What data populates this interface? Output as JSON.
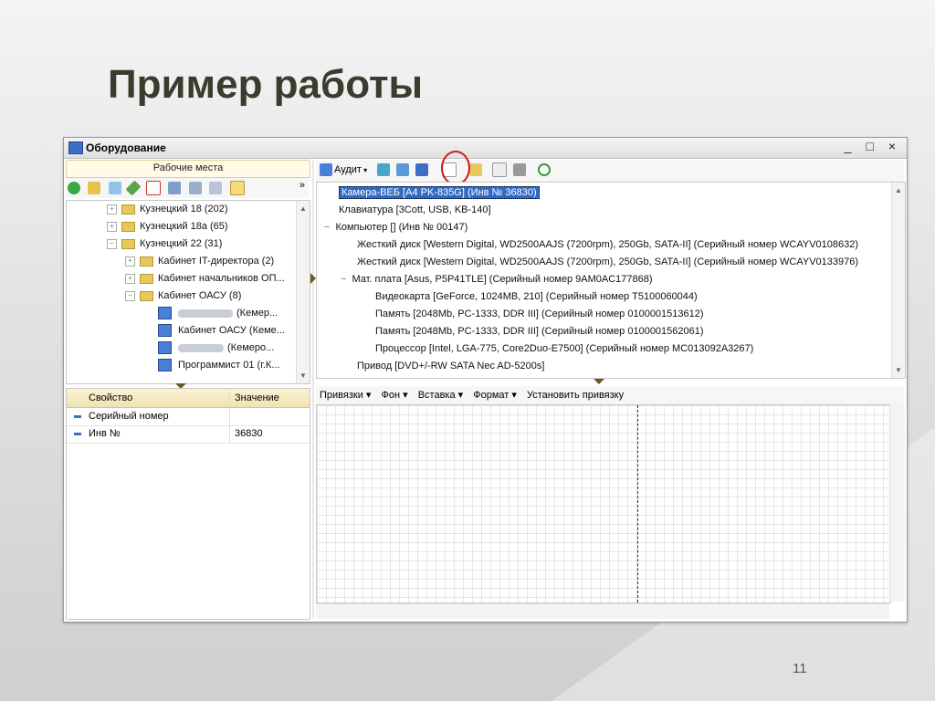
{
  "slide": {
    "title": "Пример работы",
    "page_number": "11"
  },
  "window": {
    "title": "Оборудование",
    "controls": [
      "_",
      "□",
      "×"
    ]
  },
  "left_panel": {
    "header": "Рабочие места",
    "more": "»",
    "tree": [
      {
        "label": "Кузнецкий 18 (202)",
        "level": 1,
        "expander": "+",
        "icon": "folder-icon"
      },
      {
        "label": "Кузнецкий 18а (65)",
        "level": 1,
        "expander": "+",
        "icon": "folder-icon"
      },
      {
        "label": "Кузнецкий 22 (31)",
        "level": 1,
        "expander": "−",
        "icon": "folder-icon"
      },
      {
        "label": "Кабинет IT-директора (2)",
        "level": 2,
        "expander": "+",
        "icon": "folder-icon"
      },
      {
        "label": "Кабинет начальников ОП...",
        "level": 2,
        "expander": "+",
        "icon": "folder-icon"
      },
      {
        "label": "Кабинет ОАСУ (8)",
        "level": 2,
        "expander": "−",
        "icon": "folder-icon"
      },
      {
        "label": "(Кемер...",
        "level": 3,
        "icon": "computer-icon",
        "blurred": true
      },
      {
        "label": "Кабинет ОАСУ (Кеме...",
        "level": 3,
        "icon": "computer-icon"
      },
      {
        "label": "(Кемеро...",
        "level": 3,
        "icon": "computer-icon",
        "blurred": true
      },
      {
        "label": "Программист 01 (г.К...",
        "level": 3,
        "icon": "computer-icon"
      }
    ]
  },
  "properties": {
    "col_property": "Свойство",
    "col_value": "Значение",
    "rows": [
      {
        "name": "Серийный номер",
        "value": ""
      },
      {
        "name": "Инв №",
        "value": "36830"
      }
    ]
  },
  "right_toolbar": {
    "audit_label": "Аудит"
  },
  "equipment_tree": [
    {
      "label": "Камера-ВЕБ [A4 PK-835G] (Инв № 36830)",
      "level": 0,
      "selected": true
    },
    {
      "label": "Клавиатура [3Cott, USB, KB-140]",
      "level": 0
    },
    {
      "label": "Компьютер  [] (Инв № 00147)",
      "level": 0,
      "expander": "−"
    },
    {
      "label": "Жесткий диск [Western Digital, WD2500AAJS (7200rpm), 250Gb, SATA-II] (Серийный номер WCAYV0108632)",
      "level": 1
    },
    {
      "label": "Жесткий диск [Western Digital, WD2500AAJS (7200rpm), 250Gb, SATA-II] (Серийный номер WCAYV0133976)",
      "level": 1
    },
    {
      "label": "Мат. плата [Asus, P5P41TLE] (Серийный номер 9AM0AC177868)",
      "level": 1,
      "expander": "−"
    },
    {
      "label": "Видеокарта [GeForce, 1024MB, 210] (Серийный номер T5100060044)",
      "level": 2
    },
    {
      "label": "Память [2048Mb, PC-1333, DDR III] (Серийный номер 0100001513612)",
      "level": 2
    },
    {
      "label": "Память [2048Mb, PC-1333, DDR III] (Серийный номер 0100001562061)",
      "level": 2
    },
    {
      "label": "Процессор [Intel, LGA-775, Core2Duo-E7500] (Серийный номер MC013092A3267)",
      "level": 2
    },
    {
      "label": "Привод [DVD+/-RW SATA Nec AD-5200s]",
      "level": 1
    }
  ],
  "editor_menu": [
    "Привязки ▾",
    "Фон ▾",
    "Вставка ▾",
    "Формат ▾",
    "Установить привязку"
  ],
  "colors": {
    "selection": "#316ac5",
    "highlight_circle": "#d01818",
    "header_bg": "#fbf3d3"
  }
}
